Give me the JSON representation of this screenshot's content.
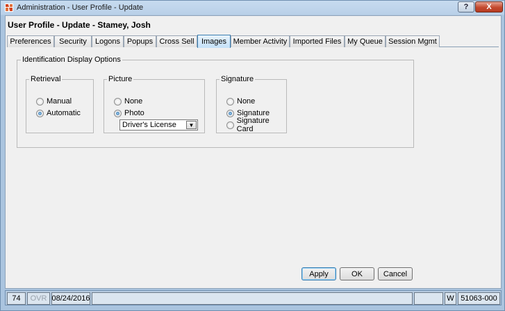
{
  "window": {
    "title": "Administration - User Profile - Update",
    "help_label": "?",
    "close_label": "X"
  },
  "page": {
    "title": "User Profile - Update - Stamey, Josh"
  },
  "tabs": [
    {
      "label": "Preferences",
      "active": false
    },
    {
      "label": "Security",
      "active": false
    },
    {
      "label": "Logons",
      "active": false
    },
    {
      "label": "Popups",
      "active": false
    },
    {
      "label": "Cross Sell",
      "active": false
    },
    {
      "label": "Images",
      "active": true
    },
    {
      "label": "Member Activity",
      "active": false
    },
    {
      "label": "Imported Files",
      "active": false
    },
    {
      "label": "My Queue",
      "active": false
    },
    {
      "label": "Session Mgmt",
      "active": false
    }
  ],
  "id_display": {
    "label": "Identification Display Options",
    "retrieval": {
      "label": "Retrieval",
      "options": [
        "Manual",
        "Automatic"
      ],
      "selected": "Automatic"
    },
    "picture": {
      "label": "Picture",
      "options": [
        "None",
        "Photo"
      ],
      "selected": "Photo",
      "document_type": "Driver's License"
    },
    "signature": {
      "label": "Signature",
      "options": [
        "None",
        "Signature",
        "Signature Card"
      ],
      "selected": "Signature"
    }
  },
  "buttons": {
    "apply": "Apply",
    "ok": "OK",
    "cancel": "Cancel"
  },
  "status_bar": {
    "cell1": "74",
    "cell2": "OVR",
    "date": "08/24/2016",
    "mode": "W",
    "code": "51063-000"
  }
}
